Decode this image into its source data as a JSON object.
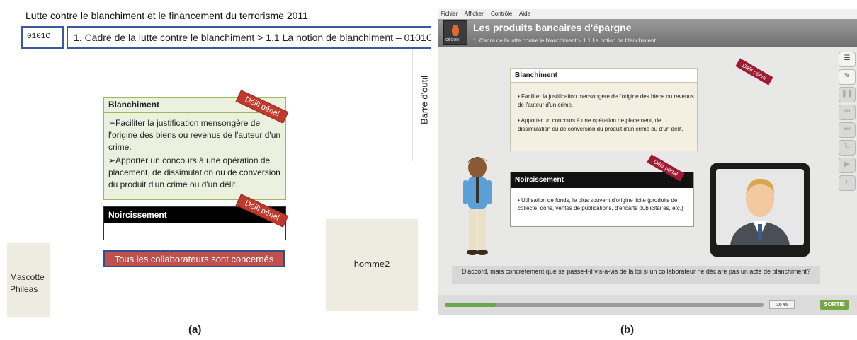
{
  "panel_a": {
    "title": "Lutte contre le blanchiment et le financement du terrorisme 2011",
    "code": "0101C",
    "path": "1. Cadre de la lutte contre le blanchiment > 1.1 La notion de blanchiment – 0101C",
    "toolbar_label": "Barre d'outil",
    "blanchiment": {
      "heading": "Blanchiment",
      "items": [
        "➢Faciliter la justification mensongère de l'origine des biens ou revenus de l'auteur d'un crime.",
        "➢Apporter un concours à une opération de placement, de dissimulation ou de conversion du produit d'un crime ou d'un délit."
      ],
      "badge": "Délit pénal"
    },
    "noircissement": {
      "heading": "Noircissement",
      "badge": "Délit pénal"
    },
    "cta_button": "Tous les collaborateurs sont concernés",
    "mascotte_line1": "Mascotte",
    "mascotte_line2": "Phileas",
    "homme": "homme2",
    "caption": "(a)"
  },
  "panel_b": {
    "menu": [
      "Fichier",
      "Afficher",
      "Contrôle",
      "Aide"
    ],
    "logo_text": "cédon",
    "title": "Les produits bancaires d'épargne",
    "breadcrumb": "1. Cadre de la lutte contre le blanchiment > 1.1 La notion de blanchiment",
    "blanchiment": {
      "heading": "Blanchiment",
      "items": [
        "• Faciliter la justification mensongère de l'origine des biens ou revenus de l'auteur d'un crime.",
        "• Apporter un concours à une opération de placement, de dissimulation ou de conversion du produit d'un crime ou d'un délit."
      ],
      "badge": "Délit pénal"
    },
    "noircissement": {
      "heading": "Noircissement",
      "item": "• Utilisation de fonds, le plus souvent d'origine licite (produits de collecte, dons, ventes de publications, d'encarts publicitaires, etc.)",
      "badge": "Délit pénal"
    },
    "dialogue": "D'accord, mais concrètement que se passe-t-il vis-à-vis de la loi si un collaborateur ne déclare pas un acte de blanchiment?",
    "progress": 0.16,
    "progress_label": "16 %",
    "exit_button": "SORTIE",
    "sidebar_icons": [
      "list-icon",
      "wrench-icon",
      "pause-icon",
      "skip-back-icon",
      "skip-forward-icon",
      "replay-icon",
      "play-icon",
      "volume-icon"
    ],
    "caption": "(b)"
  },
  "colors": {
    "badge_red": "#c0392b",
    "frame_blue": "#3a5a9c",
    "green_box": "#ebf1de",
    "progress_green": "#6aa84f"
  }
}
